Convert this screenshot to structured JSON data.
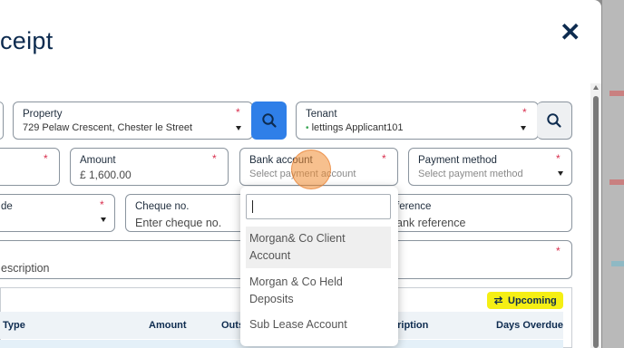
{
  "modal": {
    "title": "ceipt",
    "close_glyph": "✕"
  },
  "fields": {
    "property": {
      "label": "Property",
      "value": "729 Pelaw Crescent, Chester le Street",
      "required": "*"
    },
    "tenant": {
      "label": "Tenant",
      "value": "lettings Applicant101",
      "status_dot": "•",
      "required": "*"
    },
    "amount": {
      "label": "Amount",
      "value": "£ 1,600.00",
      "required": "*"
    },
    "bank_account": {
      "label": "Bank account",
      "placeholder": "Select payment account",
      "required": "*"
    },
    "payment_method": {
      "label": "Payment method",
      "placeholder": "Select payment method",
      "required": "*"
    },
    "left_row2": {
      "required": "*"
    },
    "left_row3": {
      "label": "de",
      "required": "*"
    },
    "cheque": {
      "label": "Cheque no.",
      "placeholder": "Enter cheque no."
    },
    "bank_reference": {
      "label": "ference",
      "placeholder": "ank reference"
    },
    "description": {
      "placeholder": "escription",
      "required": "*"
    }
  },
  "dropdown": {
    "search_value": "",
    "options": [
      {
        "line1": "Morgan& Co Client",
        "line2": "Account"
      },
      {
        "line1": "Morgan & Co Held",
        "line2": "Deposits"
      },
      {
        "line1": "Sub Lease Account",
        "line2": ""
      }
    ]
  },
  "table": {
    "badge": "Upcoming",
    "headers": [
      "Type",
      "Amount",
      "Outs",
      "cription",
      "Days Overdue"
    ]
  },
  "icons": {
    "search": "search-icon",
    "close": "close-icon",
    "swap": "swap-arrows-icon",
    "caret": "caret-down-icon"
  },
  "colors": {
    "primary_blue": "#2f7fe8",
    "badge_yellow": "#f5ef14",
    "required_red": "#d9304f",
    "title_navy": "#0d2b4f"
  }
}
